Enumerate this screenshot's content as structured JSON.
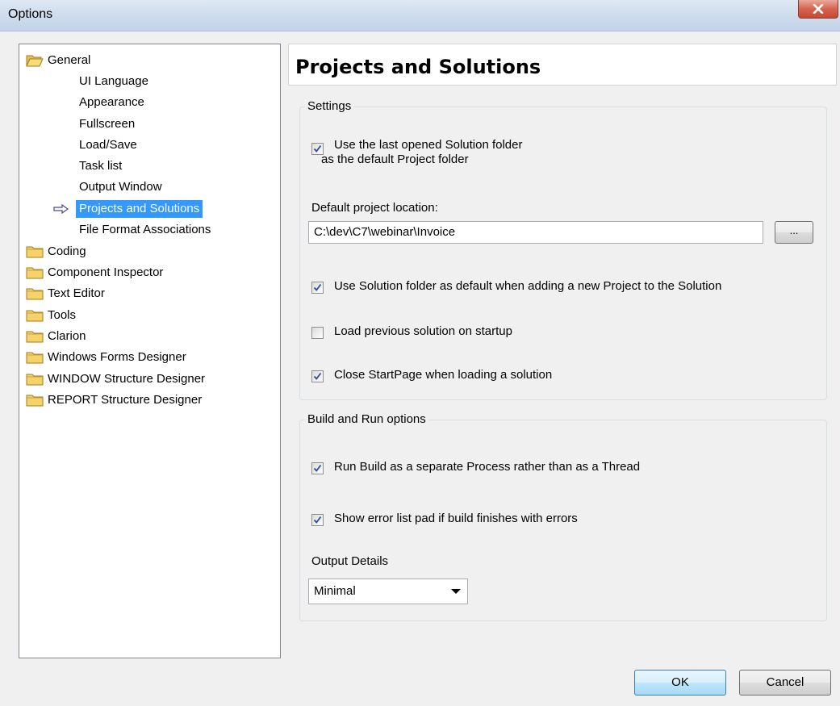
{
  "window": {
    "title": "Options",
    "close_label": "X"
  },
  "tree": {
    "general": {
      "label": "General",
      "children": [
        {
          "label": "UI Language"
        },
        {
          "label": "Appearance"
        },
        {
          "label": "Fullscreen"
        },
        {
          "label": "Load/Save"
        },
        {
          "label": "Task list"
        },
        {
          "label": "Output Window"
        },
        {
          "label": "Projects and Solutions",
          "selected": true
        },
        {
          "label": "File Format Associations"
        }
      ]
    },
    "categories": [
      {
        "label": "Coding"
      },
      {
        "label": "Component Inspector"
      },
      {
        "label": "Text Editor"
      },
      {
        "label": "Tools"
      },
      {
        "label": "Clarion"
      },
      {
        "label": "Windows Forms Designer"
      },
      {
        "label": "WINDOW Structure Designer"
      },
      {
        "label": "REPORT Structure Designer"
      }
    ]
  },
  "panel": {
    "title": "Projects and Solutions",
    "settings": {
      "group_label": "Settings",
      "use_last_folder": {
        "line1": "Use the last opened Solution folder",
        "line2": "as the default Project folder",
        "checked": true
      },
      "default_location_label": "Default project location:",
      "default_location_value": "C:\\dev\\C7\\webinar\\Invoice",
      "browse_label": "...",
      "use_solution_folder": {
        "label": "Use Solution folder as default when adding a new Project to the Solution",
        "checked": true
      },
      "load_previous": {
        "label": "Load previous solution on startup",
        "checked": false
      },
      "close_startpage": {
        "label": "Close StartPage when loading a solution",
        "checked": true
      }
    },
    "build": {
      "group_label": "Build and Run options",
      "separate_process": {
        "label": "Run Build as a separate Process rather than as a Thread",
        "checked": true
      },
      "show_error_list": {
        "label": "Show error list pad if build finishes with errors",
        "checked": true
      },
      "output_details_label": "Output Details",
      "output_details_value": "Minimal"
    }
  },
  "buttons": {
    "ok": "OK",
    "cancel": "Cancel"
  },
  "colors": {
    "selection": "#3399ff",
    "folder": "#f5d36a"
  }
}
